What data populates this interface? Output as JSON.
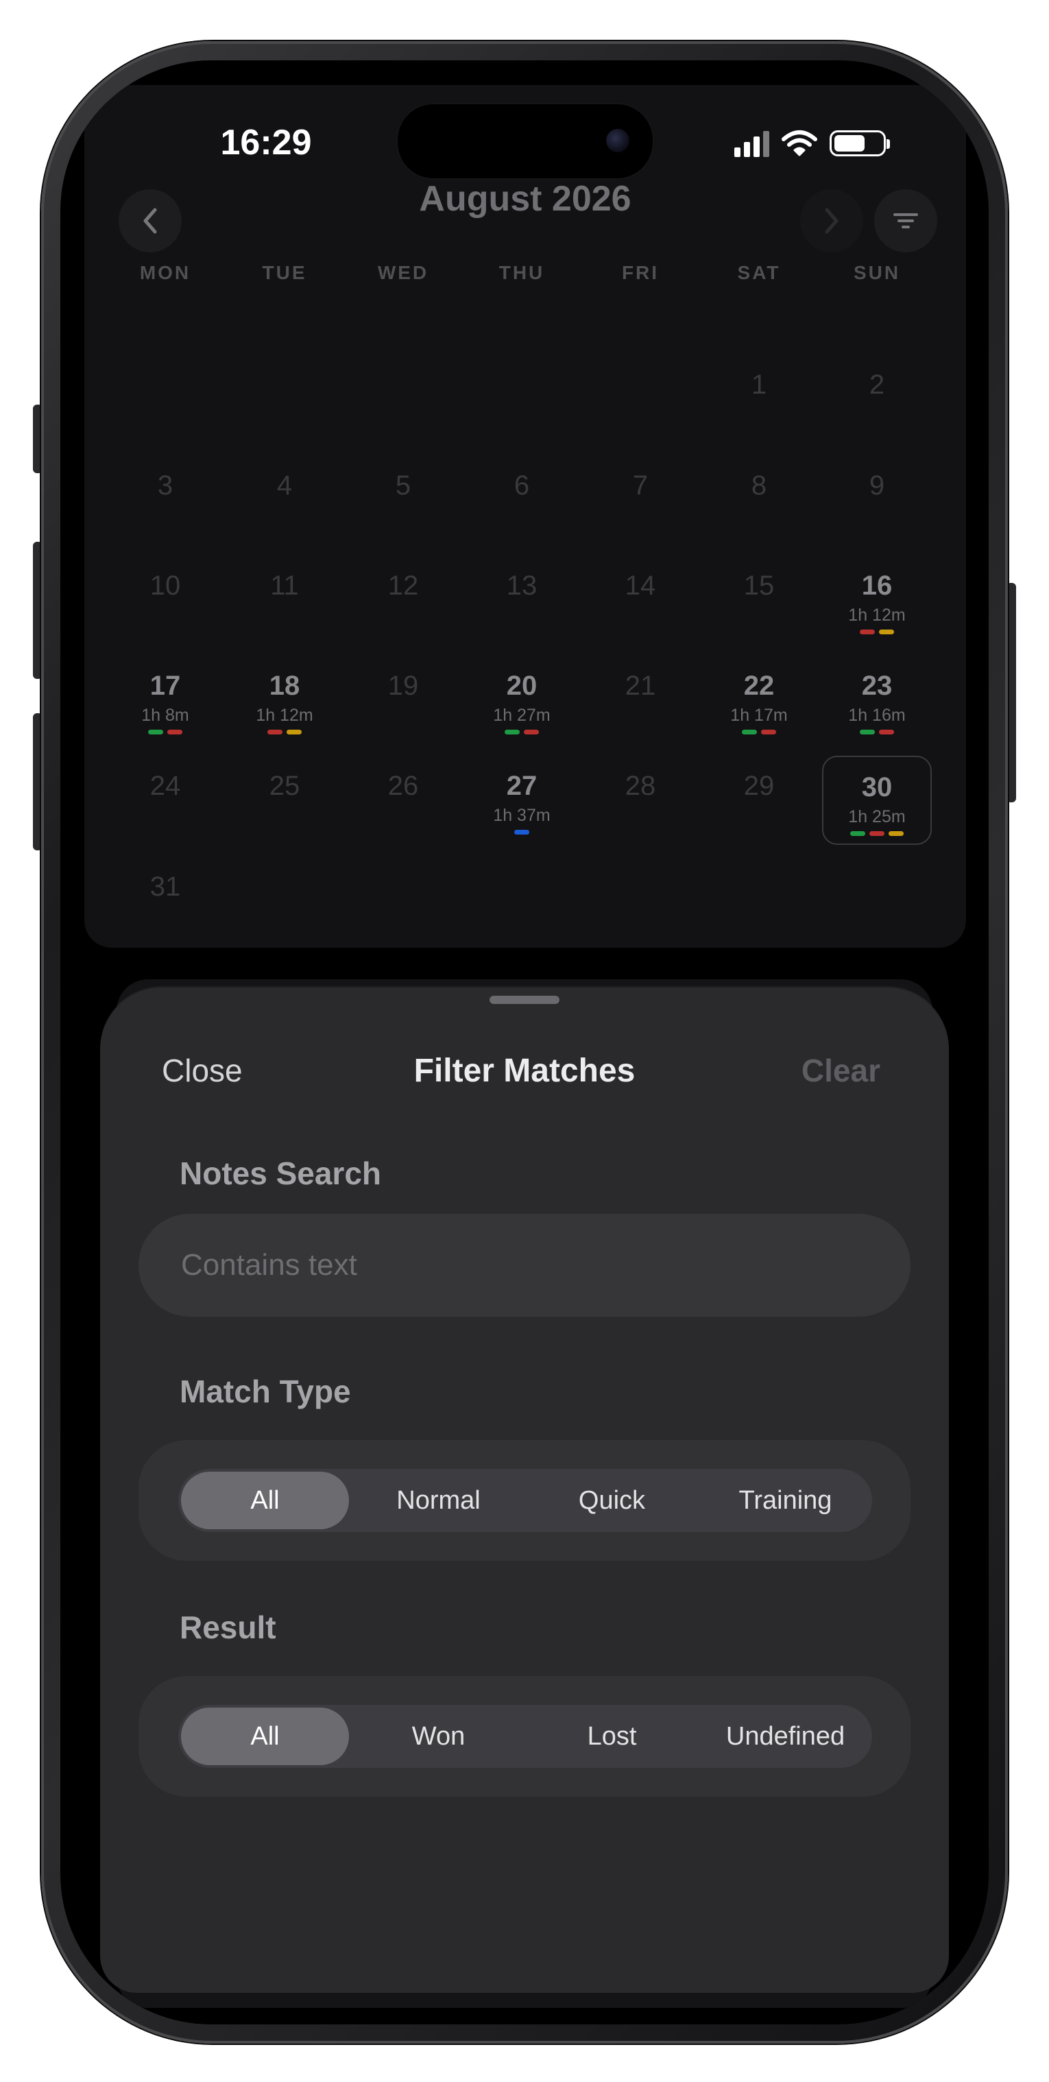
{
  "status_bar": {
    "time": "16:29"
  },
  "calendar": {
    "month_title": "August 2026",
    "weekdays": [
      "MON",
      "TUE",
      "WED",
      "THU",
      "FRI",
      "SAT",
      "SUN"
    ],
    "days": [
      {
        "n": "1"
      },
      {
        "n": "2"
      },
      {
        "n": "3"
      },
      {
        "n": "4"
      },
      {
        "n": "5"
      },
      {
        "n": "6"
      },
      {
        "n": "7"
      },
      {
        "n": "8"
      },
      {
        "n": "9"
      },
      {
        "n": "10"
      },
      {
        "n": "11"
      },
      {
        "n": "12"
      },
      {
        "n": "13"
      },
      {
        "n": "14"
      },
      {
        "n": "15"
      },
      {
        "n": "16",
        "dur": "1h 12m",
        "dots": [
          "#b8312f",
          "#c99a0e"
        ]
      },
      {
        "n": "17",
        "dur": "1h 8m",
        "dots": [
          "#1f9a45",
          "#b8312f"
        ]
      },
      {
        "n": "18",
        "dur": "1h 12m",
        "dots": [
          "#b8312f",
          "#c99a0e"
        ]
      },
      {
        "n": "19"
      },
      {
        "n": "20",
        "dur": "1h 27m",
        "dots": [
          "#1f9a45",
          "#b8312f"
        ]
      },
      {
        "n": "21"
      },
      {
        "n": "22",
        "dur": "1h 17m",
        "dots": [
          "#1f9a45",
          "#b8312f"
        ]
      },
      {
        "n": "23",
        "dur": "1h 16m",
        "dots": [
          "#1f9a45",
          "#b8312f"
        ]
      },
      {
        "n": "24"
      },
      {
        "n": "25"
      },
      {
        "n": "26"
      },
      {
        "n": "27",
        "dur": "1h 37m",
        "dots": [
          "#1a5bd6"
        ]
      },
      {
        "n": "28"
      },
      {
        "n": "29"
      },
      {
        "n": "30",
        "dur": "1h 25m",
        "dots": [
          "#1f9a45",
          "#b8312f",
          "#c99a0e"
        ],
        "selected": true
      },
      {
        "n": "31"
      }
    ]
  },
  "filter_sheet": {
    "close_label": "Close",
    "title": "Filter Matches",
    "clear_label": "Clear",
    "notes_search": {
      "label": "Notes Search",
      "placeholder": "Contains text",
      "value": ""
    },
    "match_type": {
      "label": "Match Type",
      "options": [
        "All",
        "Normal",
        "Quick",
        "Training"
      ],
      "selected": "All"
    },
    "result": {
      "label": "Result",
      "options": [
        "All",
        "Won",
        "Lost",
        "Undefined"
      ],
      "selected": "All"
    }
  },
  "icons": {
    "prev": "chevron-left-icon",
    "next": "chevron-right-icon",
    "filter": "filter-lines-icon",
    "signal": "cellular-signal-icon",
    "wifi": "wifi-icon",
    "battery": "battery-icon"
  }
}
